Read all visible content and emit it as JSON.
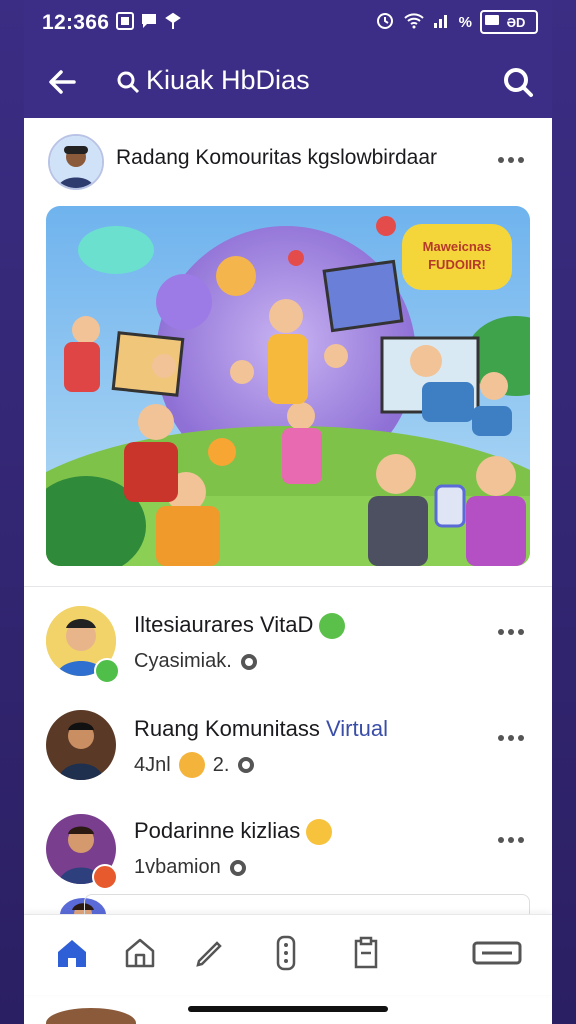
{
  "status_bar": {
    "time": "12:366",
    "battery_text": "ƏD"
  },
  "app_bar": {
    "title": "Kiuak HbDias",
    "back_icon": "arrow-left-icon",
    "search_icon": "search-icon"
  },
  "post": {
    "author": "Radang Komouritas kgslowbirdaar",
    "menu_icon": "more-dots-icon",
    "banner_bubble": "Maweicnas FUDOIIR!"
  },
  "list": [
    {
      "title": "Iltesiaurares VitaD",
      "meta": "Cyasimiak.",
      "emoji": "green-smile",
      "badge": "green"
    },
    {
      "title": "Ruang Komunitass",
      "title_accent": "Virtual",
      "meta": "4Jnl",
      "meta_suffix": "2.",
      "emoji": "yellow-wave",
      "badge": "none"
    },
    {
      "title": "Podarinne kizlias",
      "meta": "1vbamion",
      "emoji": "yellow-smile",
      "badge": "orange"
    }
  ],
  "bottom_nav": [
    {
      "name": "nav-home",
      "icon": "home-icon",
      "active": true
    },
    {
      "name": "nav-pages",
      "icon": "house-outline-icon",
      "active": false
    },
    {
      "name": "nav-edit",
      "icon": "pen-icon",
      "active": false
    },
    {
      "name": "nav-remote",
      "icon": "remote-icon",
      "active": false
    },
    {
      "name": "nav-notes",
      "icon": "clipboard-icon",
      "active": false
    },
    {
      "name": "nav-menu",
      "icon": "menu-box-icon",
      "active": false
    }
  ],
  "colors": {
    "primary": "#3c2e86",
    "accent": "#3a4ea8",
    "home_active": "#2f5fd6"
  }
}
